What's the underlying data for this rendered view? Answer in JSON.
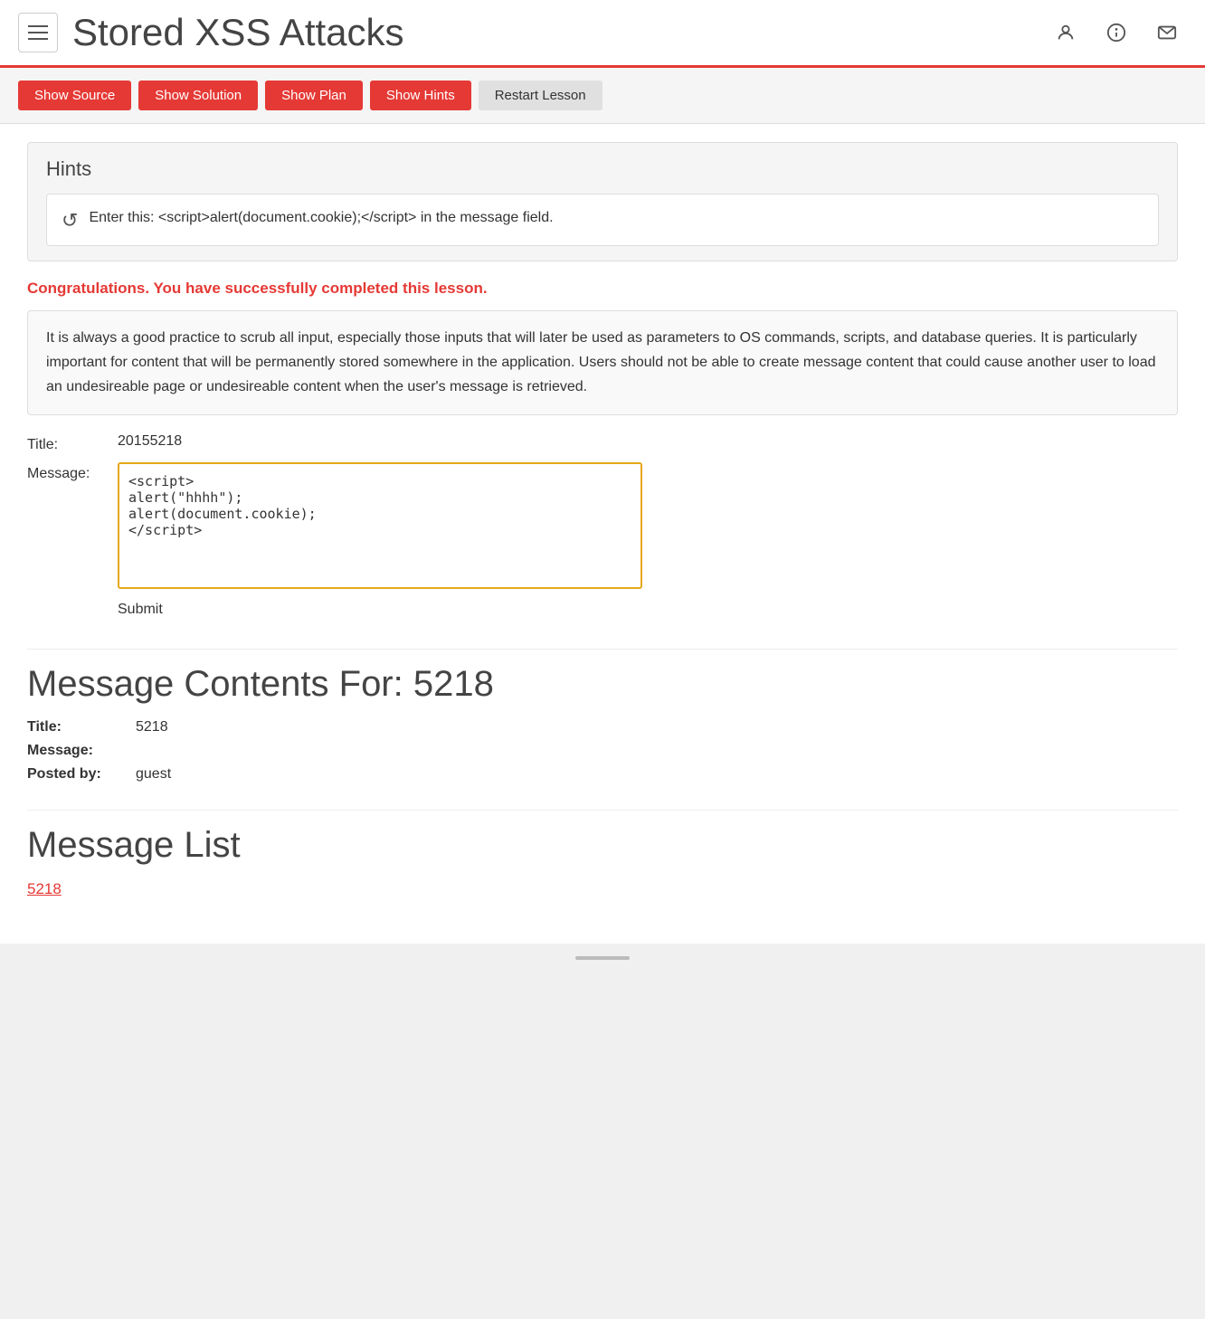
{
  "header": {
    "title": "Stored XSS Attacks",
    "menu_label": "menu"
  },
  "toolbar": {
    "show_source_label": "Show Source",
    "show_solution_label": "Show Solution",
    "show_plan_label": "Show Plan",
    "show_hints_label": "Show Hints",
    "restart_lesson_label": "Restart Lesson"
  },
  "hints": {
    "title": "Hints",
    "items": [
      {
        "icon": "↩",
        "text": "Enter this: <script>alert(document.cookie);</script> in the message field."
      }
    ]
  },
  "success": {
    "message": "Congratulations. You have successfully completed this lesson."
  },
  "description": {
    "text": "It is always a good practice to scrub all input, especially those inputs that will later be used as parameters to OS commands, scripts, and database queries. It is particularly important for content that will be permanently stored somewhere in the application. Users should not be able to create message content that could cause another user to load an undesireable page or undesireable content when the user's message is retrieved."
  },
  "form": {
    "title_label": "Title:",
    "title_value": "20155218",
    "message_label": "Message:",
    "message_value": "<script>\nalert(\"hhhh\");\nalert(document.cookie);\n</script>",
    "submit_label": "Submit"
  },
  "message_contents": {
    "section_title": "Message Contents For: 5218",
    "title_label": "Title:",
    "title_value": "5218",
    "message_label": "Message:",
    "message_value": "",
    "posted_by_label": "Posted by:",
    "posted_by_value": "guest"
  },
  "message_list": {
    "section_title": "Message List",
    "items": [
      {
        "link_text": "5218",
        "link_href": "#"
      }
    ]
  }
}
